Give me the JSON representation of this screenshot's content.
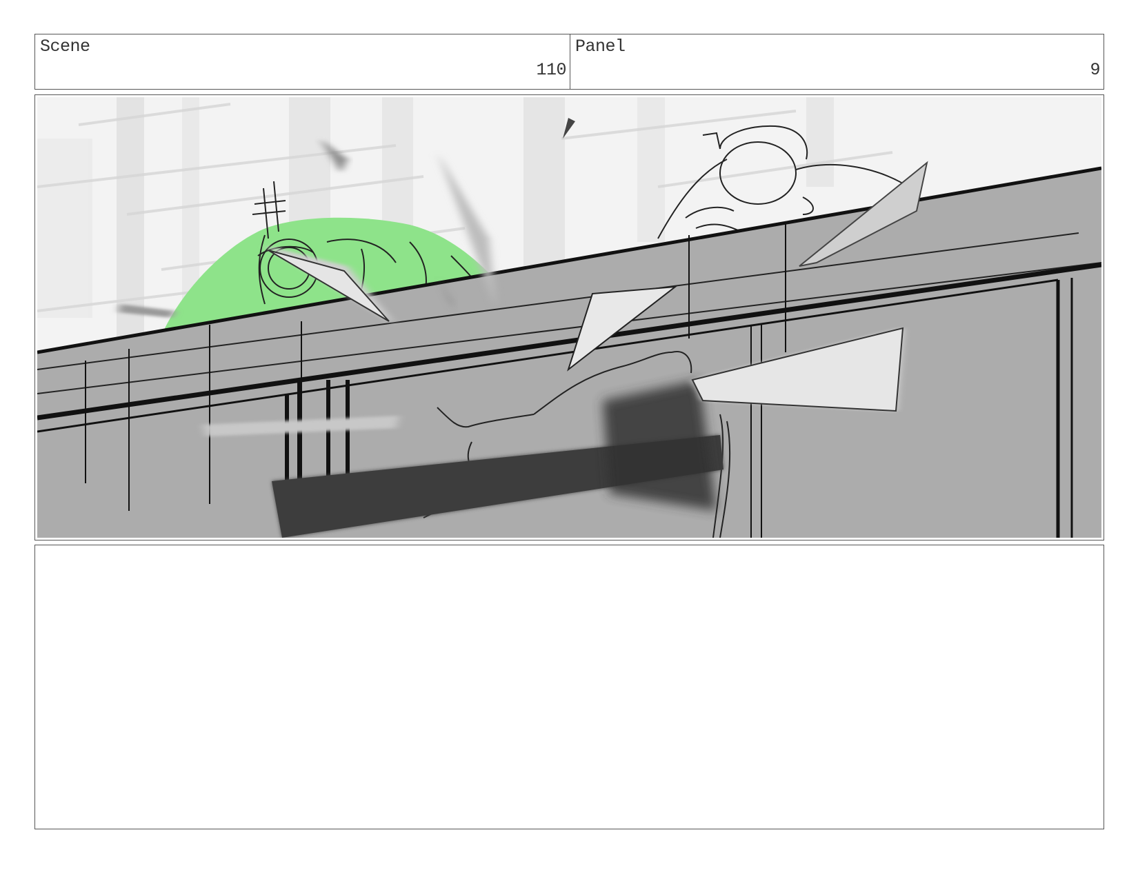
{
  "header": {
    "scene_label": "Scene",
    "scene_number": "110",
    "panel_label": "Panel",
    "panel_number": "9"
  },
  "artwork": {
    "character_highlight_color": "#8ee38a",
    "wall_color": "#acacac",
    "background_color": "#f1f1f1"
  },
  "notes": {
    "text": ""
  }
}
